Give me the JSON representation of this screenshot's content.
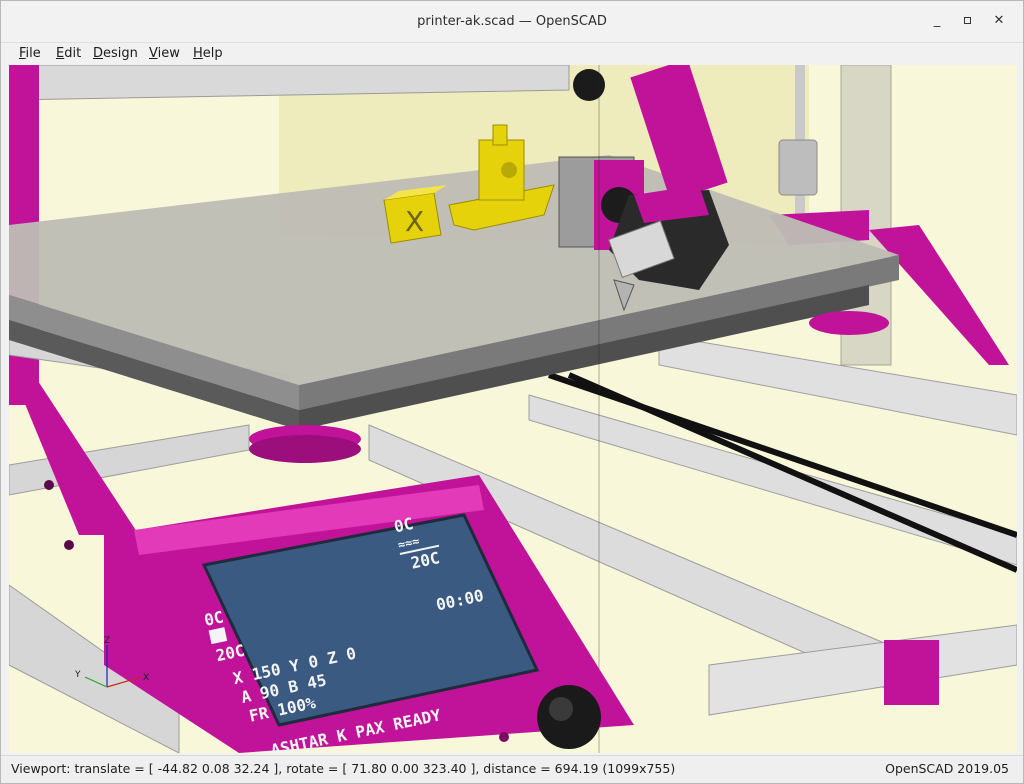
{
  "window": {
    "title": "printer-ak.scad — OpenSCAD",
    "minimize_glyph": "_",
    "close_glyph": "✕"
  },
  "menu": {
    "items": [
      {
        "label_u": "F",
        "label_rest": "ile"
      },
      {
        "label_u": "E",
        "label_rest": "dit"
      },
      {
        "label_u": "D",
        "label_rest": "esign"
      },
      {
        "label_u": "V",
        "label_rest": "iew"
      },
      {
        "label_u": "H",
        "label_rest": "elp"
      }
    ]
  },
  "scene": {
    "background": "#f9f7d9",
    "accent_magenta": "#c0139a",
    "print_color": "#e6d20a",
    "cube_letter": "X",
    "axes": {
      "x": "X",
      "y": "Y",
      "z": "Z"
    },
    "lcd": {
      "bed_temp": "0C",
      "bed_target": "20C",
      "hotend_temp": "0C",
      "hotend_target": "20C",
      "heat_glyph": "≈≈≈",
      "position_line": "X 150  Y 0  Z 0",
      "time": "00:00",
      "ab_line": "A 90 B 45",
      "feedrate": "FR 100%",
      "status": "ASHTAR K PAX READY"
    }
  },
  "status": {
    "viewport": "Viewport: translate = [ -44.82 0.08 32.24 ], rotate = [ 71.80 0.00 323.40 ], distance = 694.19 (1099x755)",
    "version": "OpenSCAD 2019.05"
  }
}
